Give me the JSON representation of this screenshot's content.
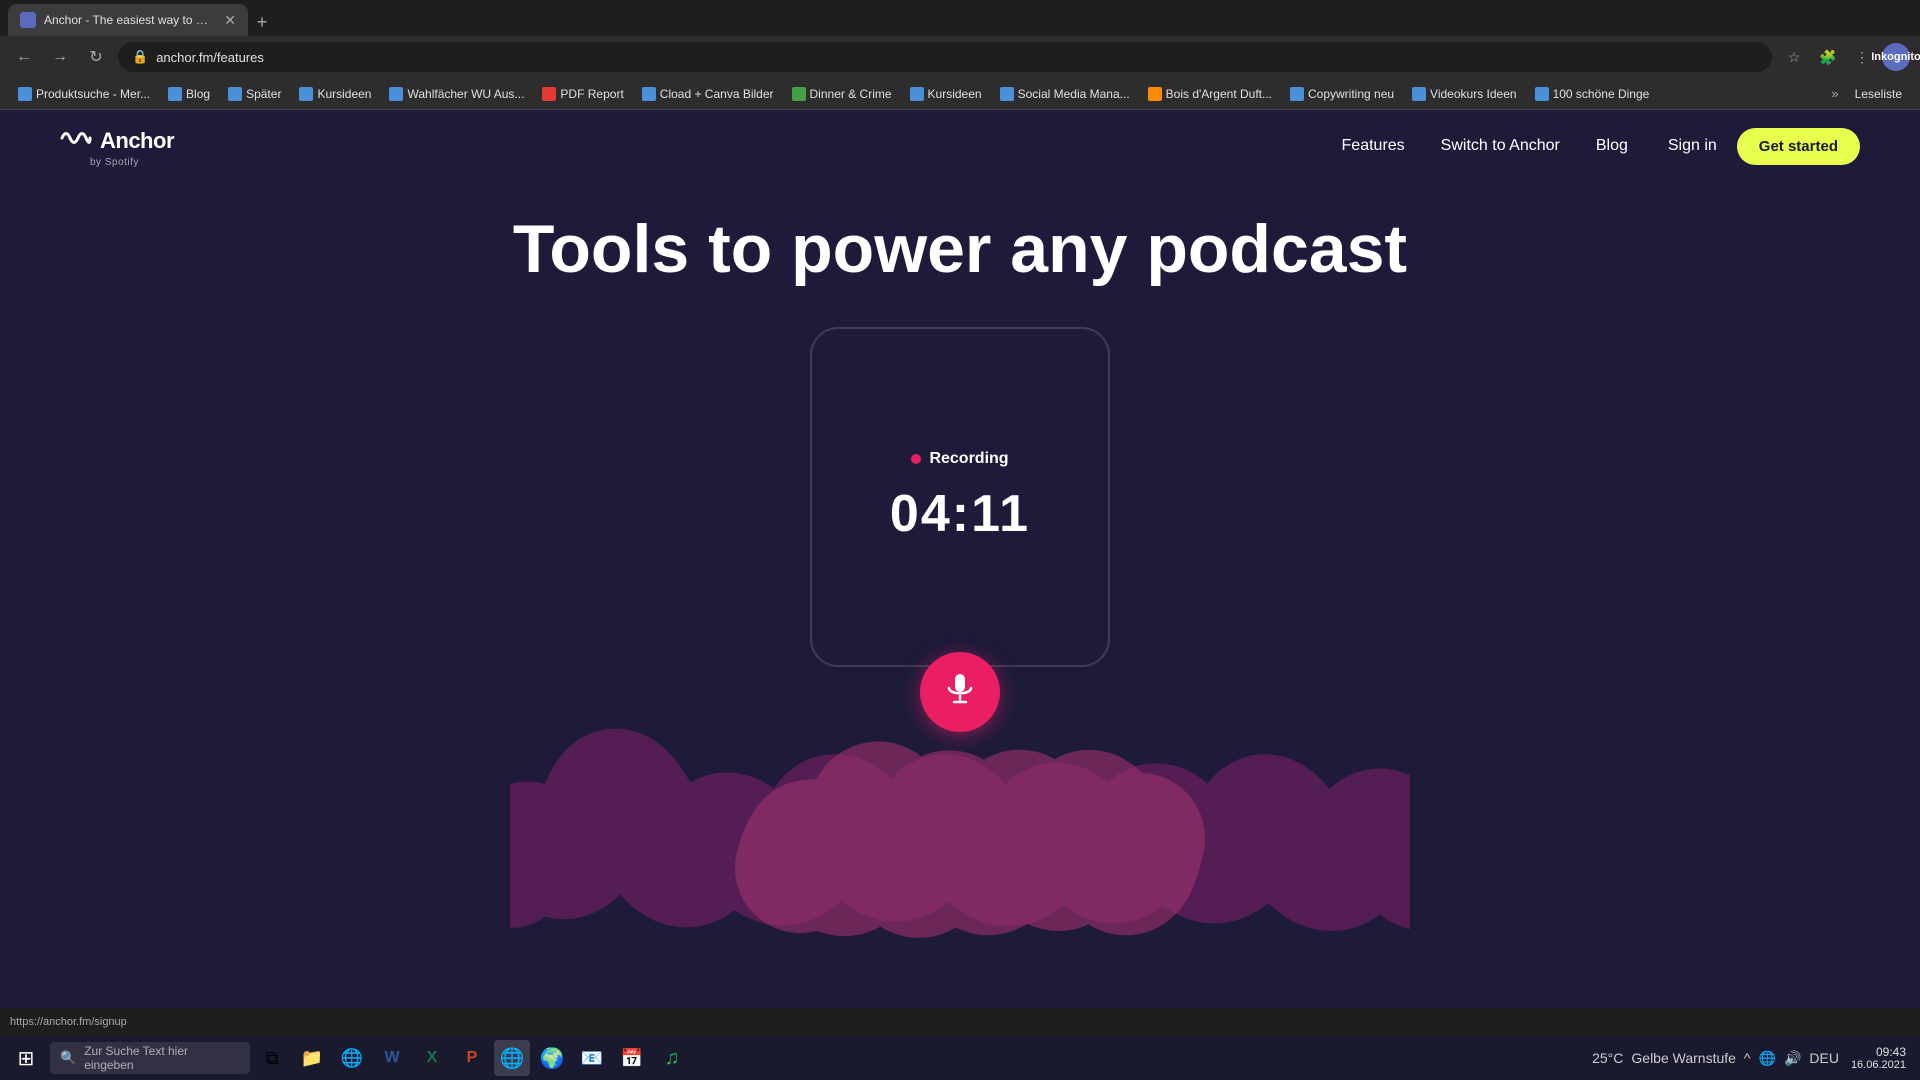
{
  "browser": {
    "tab": {
      "title": "Anchor - The easiest way to ma...",
      "favicon": "A",
      "new_tab_label": "+"
    },
    "address_bar": {
      "url": "anchor.fm/features"
    },
    "bookmarks": [
      {
        "label": "Produktsuche - Mer...",
        "icon_color": "blue"
      },
      {
        "label": "Blog",
        "icon_color": "blue"
      },
      {
        "label": "Später",
        "icon_color": "blue"
      },
      {
        "label": "Kursideen",
        "icon_color": "blue"
      },
      {
        "label": "Wahlfächer WU Aus...",
        "icon_color": "blue"
      },
      {
        "label": "PDF Report",
        "icon_color": "red"
      },
      {
        "label": "Cload + Canva Bilder",
        "icon_color": "blue"
      },
      {
        "label": "Dinner & Crime",
        "icon_color": "green"
      },
      {
        "label": "Kursideen",
        "icon_color": "blue"
      },
      {
        "label": "Social Media Mana...",
        "icon_color": "blue"
      },
      {
        "label": "Bois d'Argent Duft...",
        "icon_color": "orange"
      },
      {
        "label": "Copywriting neu",
        "icon_color": "blue"
      },
      {
        "label": "Videokurs Ideen",
        "icon_color": "blue"
      },
      {
        "label": "100 schöne Dinge",
        "icon_color": "blue"
      }
    ],
    "profile_label": "In",
    "profile_tooltip": "Inkognito"
  },
  "nav": {
    "logo_brand": "Anchor",
    "logo_subtitle": "by Spotify",
    "logo_icon": "∿",
    "links": [
      {
        "label": "Features",
        "href": "/features"
      },
      {
        "label": "Switch to Anchor",
        "href": "/switch"
      },
      {
        "label": "Blog",
        "href": "/blog"
      }
    ],
    "sign_in_label": "Sign in",
    "get_started_label": "Get started"
  },
  "hero": {
    "title": "Tools to power any podcast",
    "recording_label": "Recording",
    "timer": "04:11",
    "recording_dot_color": "#e91e63"
  },
  "status_bar": {
    "url": "https://anchor.fm/signup"
  },
  "taskbar": {
    "search_placeholder": "Zur Suche Text hier eingeben",
    "system_tray": {
      "temperature": "25°C",
      "weather_label": "Gelbe Warnstufe",
      "time": "09:43",
      "date": "16.06.2021",
      "keyboard": "DEU"
    }
  }
}
